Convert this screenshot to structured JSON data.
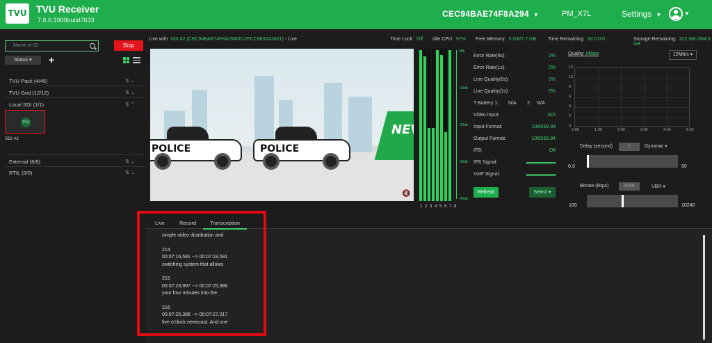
{
  "header": {
    "logo_text": "TVU",
    "title": "TVU Receiver",
    "version": "7.6.0.1000build7633",
    "device_id": "CEC94BAE74F8A294",
    "pm": "PM_X7L",
    "settings": "Settings"
  },
  "sidebar": {
    "search_placeholder": "Name or ID",
    "stop_label": "Stop",
    "status_label": "Status",
    "groups": [
      {
        "label": "TVU Pack (4/45)"
      },
      {
        "label": "TVU Grid (12/12)"
      },
      {
        "label": "Local SDI (1/1)"
      },
      {
        "label": "External (8/8)"
      },
      {
        "label": "RTIL (0/0)"
      }
    ],
    "sdi_label": "SDI #2",
    "sdi_dot": "TVU"
  },
  "infobar": {
    "live_with_label": "Live with",
    "live_with_value": "SDI #2 (CEC94BAE74F8A2940012FCC9832A3801)",
    "live_suffix": "- Live",
    "time_lock_label": "Time Lock:",
    "time_lock_value": "Off",
    "idle_cpu_label": "Idle CPU:",
    "idle_cpu_value": "57%",
    "free_mem_label": "Free Memory:",
    "free_mem_value": "3 GB/7.7 GB",
    "time_rem_label": "Time Remaining:",
    "time_rem_value": "0d 0:0:0",
    "storage_label": "Storage Remaining:",
    "storage_value": "322 GB /364.9 GB"
  },
  "video": {
    "police_text": "POLICE",
    "news_text": "NEV"
  },
  "meters": {
    "channels_label": "1 2 3 4 5 6 7 8",
    "db_labels": [
      "0db",
      "-10db",
      "-20db",
      "-30db",
      "-40db"
    ],
    "levels": [
      0.99,
      0.95,
      0.48,
      0.48,
      0.99,
      0.96,
      0.45,
      0.99
    ]
  },
  "stats": {
    "rows": [
      {
        "label": "Error Rate(8s):",
        "value": "0%"
      },
      {
        "label": "Error Rate(1s):",
        "value": "0%"
      },
      {
        "label": "Line Quality(8s):",
        "value": "0%"
      },
      {
        "label": "Line Quality(1s):",
        "value": "0%"
      },
      {
        "label": "T Battery 1:",
        "value": ""
      },
      {
        "label": "Video Input:",
        "value": "SDI"
      },
      {
        "label": "Input Format:",
        "value": "1080i59.94"
      },
      {
        "label": "Output Format:",
        "value": "1080i59.94"
      },
      {
        "label": "IFB:",
        "value": "Off"
      },
      {
        "label": "IFB Signal:",
        "value": ""
      },
      {
        "label": "VoIP Signal:",
        "value": ""
      }
    ],
    "battery1": "N/A",
    "battery2_label": "2:",
    "battery2": "N/A",
    "refresh": "Refresh",
    "select": "Select"
  },
  "quality_chart": {
    "label": "Quality:",
    "value": "0kbps",
    "rate_option": "12Mb/s",
    "y_ticks": [
      "12",
      "10",
      "8",
      "6",
      "4",
      "2",
      "0"
    ],
    "x_ticks": [
      "0:00",
      "1:00",
      "2:00",
      "3:00",
      "4:00",
      "5:00"
    ]
  },
  "delay": {
    "label": "Delay (second)",
    "input_value": "1",
    "mode": "Dynamic",
    "min": "0.3",
    "max": "50",
    "level": 0
  },
  "bitrate": {
    "label": "Bitrate (kbps)",
    "input_value": "4096",
    "mode": "VBR",
    "min": "100",
    "max": "10240",
    "level": 0.39
  },
  "bottom": {
    "tabs": [
      "Live",
      "Record",
      "Transcription"
    ],
    "transcript": [
      [
        "simple video distribution and"
      ],
      [
        "214",
        "00:07:16,591 --> 00:07:18,591",
        "switching system that allows"
      ],
      [
        "215",
        "00:07:23,997 --> 00:07:25,386",
        "your four minutes into the"
      ],
      [
        "216",
        "00:07:25,386 --> 00:07:27,017",
        "five o'clock newscast. And one"
      ]
    ]
  },
  "colors": {
    "brand_green": "#1fae4e",
    "accent_red": "#e4141b",
    "highlight_red": "#e00a12"
  }
}
